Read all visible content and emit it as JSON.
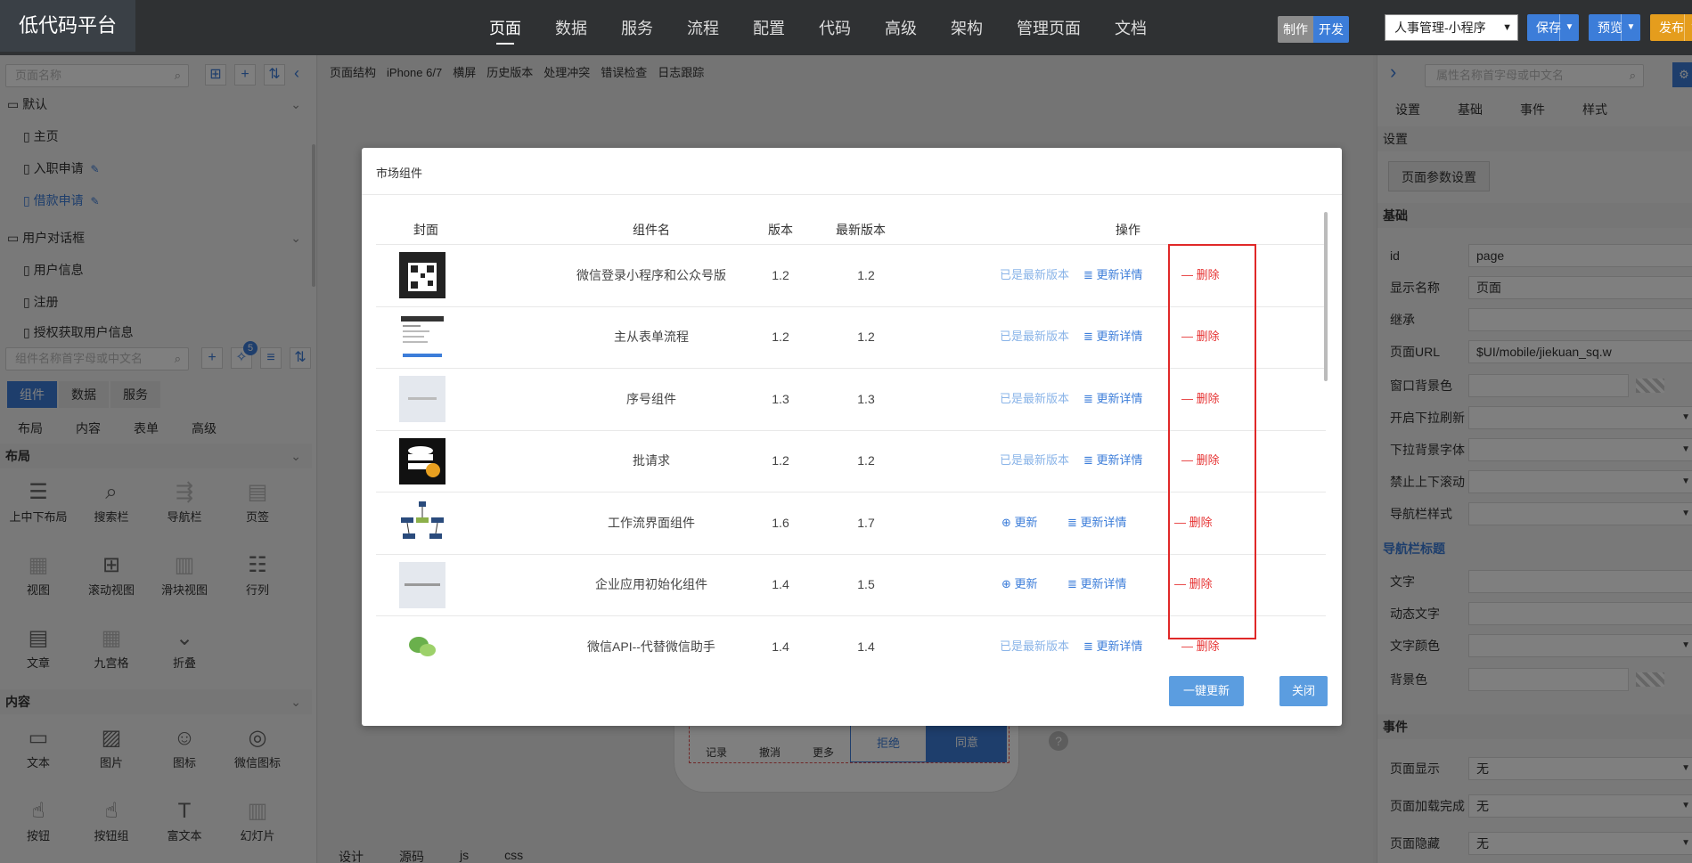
{
  "app": {
    "logo": "低代码平台",
    "nav": [
      "页面",
      "数据",
      "服务",
      "流程",
      "配置",
      "代码",
      "高级",
      "架构",
      "管理页面",
      "文档"
    ],
    "mode_make": "制作",
    "mode_dev": "开发",
    "app_select": "人事管理-小程序",
    "save": "保存",
    "preview": "预览",
    "publish": "发布"
  },
  "left": {
    "page_search_placeholder": "页面名称",
    "groups": [
      {
        "label": "默认",
        "items": [
          {
            "label": "主页"
          },
          {
            "label": "入职申请"
          },
          {
            "label": "借款申请"
          }
        ]
      },
      {
        "label": "用户对话框",
        "items": [
          {
            "label": "用户信息"
          },
          {
            "label": "注册"
          },
          {
            "label": "授权获取用户信息"
          }
        ]
      }
    ],
    "comp_search_placeholder": "组件名称首字母或中文名",
    "badge": "5",
    "tabs": [
      "组件",
      "数据",
      "服务"
    ],
    "subtabs": [
      "布局",
      "内容",
      "表单",
      "高级"
    ],
    "sections": [
      {
        "label": "布局",
        "items": [
          "上中下布局",
          "搜索栏",
          "导航栏",
          "页签",
          "视图",
          "滚动视图",
          "滑块视图",
          "行列",
          "文章",
          "九宫格",
          "折叠"
        ]
      },
      {
        "label": "内容",
        "items": [
          "文本",
          "图片",
          "图标",
          "微信图标",
          "按钮",
          "按钮组",
          "富文本",
          "幻灯片"
        ]
      }
    ]
  },
  "center": {
    "toolbar": [
      "页面结构",
      "iPhone 6/7",
      "横屏",
      "历史版本",
      "处理冲突",
      "错误检查",
      "日志跟踪"
    ],
    "phone_buttons": [
      "记录",
      "撤消",
      "更多"
    ],
    "reject": "拒绝",
    "agree": "同意",
    "bottom_tabs": [
      "设计",
      "源码",
      "js",
      "css"
    ]
  },
  "modal": {
    "title": "市场组件",
    "headers": [
      "封面",
      "组件名",
      "版本",
      "最新版本",
      "操作"
    ],
    "latest_label": "已是最新版本",
    "update_label": "更新",
    "detail_label": "更新详情",
    "delete_label": "删除",
    "rows": [
      {
        "name": "微信登录小程序和公众号版",
        "version": "1.2",
        "latest": "1.2",
        "status": "latest"
      },
      {
        "name": "主从表单流程",
        "version": "1.2",
        "latest": "1.2",
        "status": "latest"
      },
      {
        "name": "序号组件",
        "version": "1.3",
        "latest": "1.3",
        "status": "latest"
      },
      {
        "name": "批请求",
        "version": "1.2",
        "latest": "1.2",
        "status": "latest"
      },
      {
        "name": "工作流界面组件",
        "version": "1.6",
        "latest": "1.7",
        "status": "update"
      },
      {
        "name": "企业应用初始化组件",
        "version": "1.4",
        "latest": "1.5",
        "status": "update"
      },
      {
        "name": "微信API--代替微信助手",
        "version": "1.4",
        "latest": "1.4",
        "status": "latest"
      }
    ],
    "update_all": "一键更新",
    "close": "关闭"
  },
  "right": {
    "search_placeholder": "属性名称首字母或中文名",
    "tabs": [
      "设置",
      "基础",
      "事件",
      "样式"
    ],
    "section_settings": "设置",
    "page_params_btn": "页面参数设置",
    "section_basic": "基础",
    "props": [
      {
        "label": "id",
        "value": "page"
      },
      {
        "label": "显示名称",
        "value": "页面"
      },
      {
        "label": "继承",
        "value": ""
      },
      {
        "label": "页面URL",
        "value": "$UI/mobile/jiekuan_sq.w"
      },
      {
        "label": "窗口背景色",
        "value": ""
      },
      {
        "label": "开启下拉刷新",
        "value": ""
      },
      {
        "label": "下拉背景字体",
        "value": ""
      },
      {
        "label": "禁止上下滚动",
        "value": ""
      },
      {
        "label": "导航栏样式",
        "value": ""
      }
    ],
    "section_navtitle": "导航栏标题",
    "nav_props": [
      {
        "label": "文字",
        "value": ""
      },
      {
        "label": "动态文字",
        "value": ""
      },
      {
        "label": "文字颜色",
        "value": ""
      },
      {
        "label": "背景色",
        "value": ""
      }
    ],
    "section_events": "事件",
    "events": [
      {
        "label": "页面显示",
        "value": "无"
      },
      {
        "label": "页面加载完成",
        "value": "无"
      },
      {
        "label": "页面隐藏",
        "value": "无"
      }
    ]
  },
  "colors": {
    "accent": "#3c7dd9",
    "topbar": "#2f3133",
    "delete_red": "#e63333",
    "publish": "#e59d1d"
  }
}
